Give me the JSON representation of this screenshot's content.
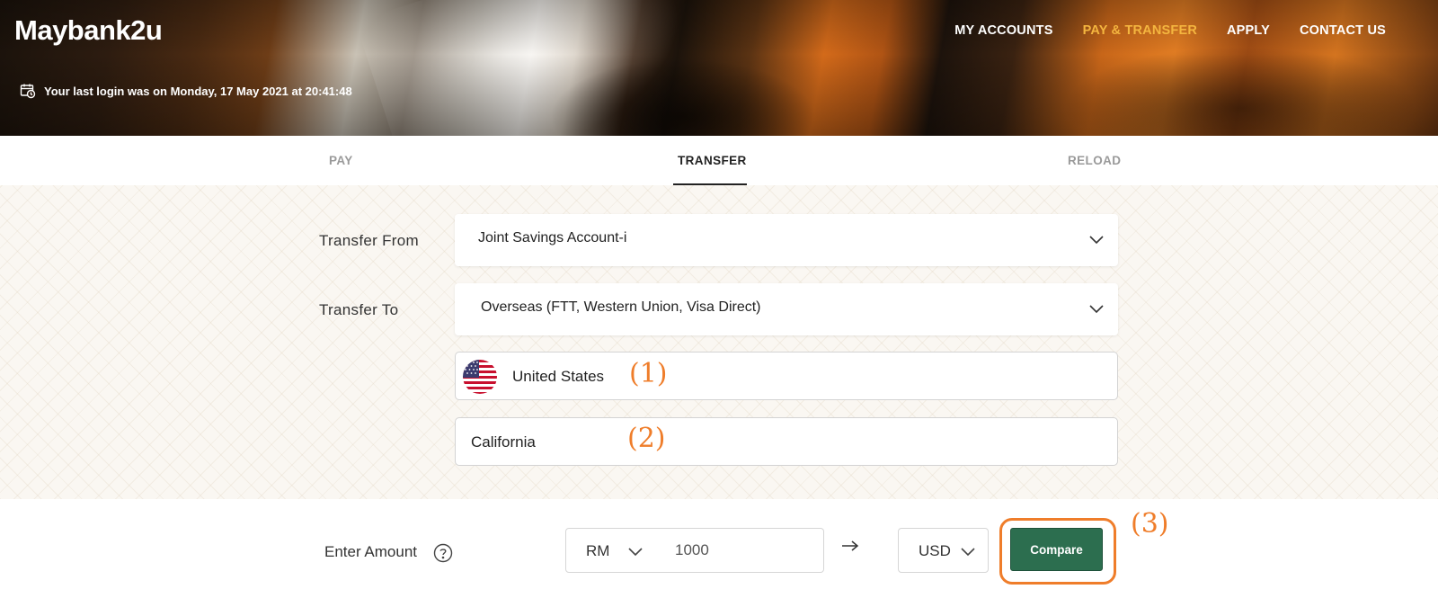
{
  "header": {
    "logo": "Maybank2u",
    "nav": [
      {
        "label": "MY ACCOUNTS",
        "active": false
      },
      {
        "label": "PAY & TRANSFER",
        "active": true
      },
      {
        "label": "APPLY",
        "active": false
      },
      {
        "label": "CONTACT US",
        "active": false
      }
    ],
    "last_login": "Your last login was on Monday, 17 May 2021 at 20:41:48",
    "accent_color": "#f4b53f"
  },
  "tabs": [
    {
      "label": "PAY",
      "active": false
    },
    {
      "label": "TRANSFER",
      "active": true
    },
    {
      "label": "RELOAD",
      "active": false
    }
  ],
  "form": {
    "transfer_from": {
      "label": "Transfer From",
      "value": "Joint Savings Account-i"
    },
    "transfer_to": {
      "label": "Transfer To",
      "value": "Overseas  (FTT, Western Union, Visa Direct)"
    },
    "country": {
      "value": "United States",
      "flag_icon": "us-flag-icon"
    },
    "state": {
      "value": "California"
    }
  },
  "amount": {
    "label": "Enter Amount",
    "from_currency": "RM",
    "value": "1000",
    "to_currency": "USD",
    "compare_label": "Compare",
    "button_color": "#2c6e4f"
  },
  "annotations": {
    "one": "(1)",
    "two": "(2)",
    "three": "(3)",
    "color": "#ef7d2a"
  }
}
